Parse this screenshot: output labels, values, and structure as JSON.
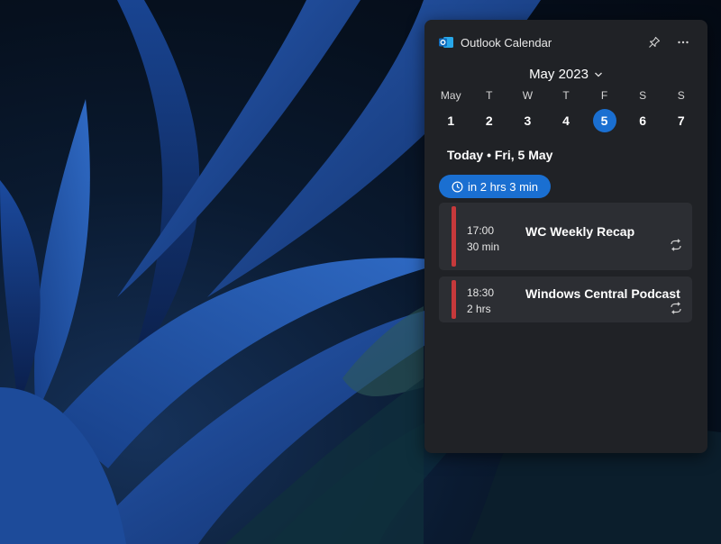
{
  "widget": {
    "app_title": "Outlook Calendar",
    "app_icon": "outlook-icon",
    "pin_icon": "pin-icon",
    "more_icon": "more-options-icon"
  },
  "calendar": {
    "month_label": "May 2023",
    "weekday_headers": [
      "May",
      "T",
      "W",
      "T",
      "F",
      "S",
      "S"
    ],
    "days": [
      "1",
      "2",
      "3",
      "4",
      "5",
      "6",
      "7"
    ],
    "selected_day": "5"
  },
  "today": {
    "label": "Today • Fri, 5 May"
  },
  "countdown": {
    "label": "in 2 hrs 3 min"
  },
  "events": [
    {
      "time": "17:00",
      "duration": "30 min",
      "title": "WC Weekly Recap",
      "recurring": true
    },
    {
      "time": "18:30",
      "duration": "2 hrs",
      "title": "Windows Central Podcast",
      "recurring": true
    }
  ],
  "colors": {
    "accent": "#1a6fd1",
    "event_bar": "#c6393b",
    "widget_bg": "#202226",
    "event_bg": "#2c2e33"
  }
}
